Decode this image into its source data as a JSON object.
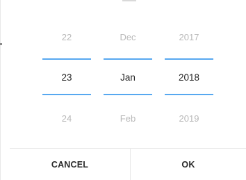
{
  "accent_color": "#57a8f0",
  "picker": {
    "day": {
      "prev": "22",
      "selected": "23",
      "next": "24"
    },
    "month": {
      "prev": "Dec",
      "selected": "Jan",
      "next": "Feb"
    },
    "year": {
      "prev": "2017",
      "selected": "2018",
      "next": "2019"
    }
  },
  "buttons": {
    "cancel": "CANCEL",
    "ok": "OK"
  }
}
